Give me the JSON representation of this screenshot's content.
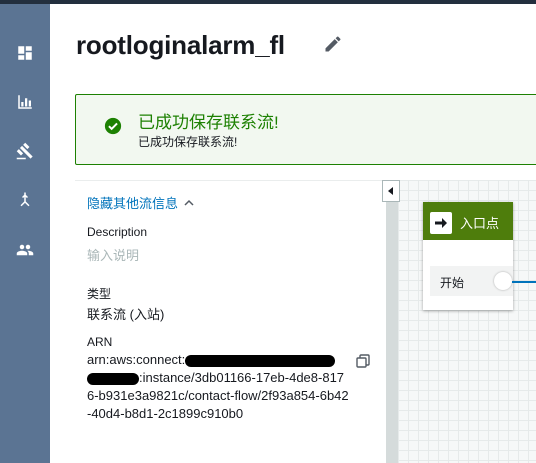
{
  "sidebar": {
    "items": [
      {
        "icon": "dashboard-icon"
      },
      {
        "icon": "bar-chart-icon"
      },
      {
        "icon": "gavel-icon"
      },
      {
        "icon": "routing-icon"
      },
      {
        "icon": "users-icon"
      }
    ]
  },
  "header": {
    "title": "rootloginalarm_fl",
    "edit_icon": "pencil-icon"
  },
  "alert": {
    "title": "已成功保存联系流!",
    "message": "已成功保存联系流!",
    "color": "#1d8102"
  },
  "details": {
    "toggle_label": "隐藏其他流信息",
    "description_label": "Description",
    "description_placeholder": "输入说明",
    "type_label": "类型",
    "type_value": "联系流 (入站)",
    "arn_label": "ARN",
    "arn_prefix": "arn:aws:connect:",
    "arn_suffix": ":instance/3db01166-17eb-4de8-8176-b931e3a9821c/contact-flow/2f93a854-6b42-40d4-b8d1-2c1899c910b0"
  },
  "canvas": {
    "entry_block": {
      "title": "入口点",
      "branch_label": "开始",
      "header_color": "#4e7d0c"
    },
    "connector_color": "#0073bb"
  }
}
